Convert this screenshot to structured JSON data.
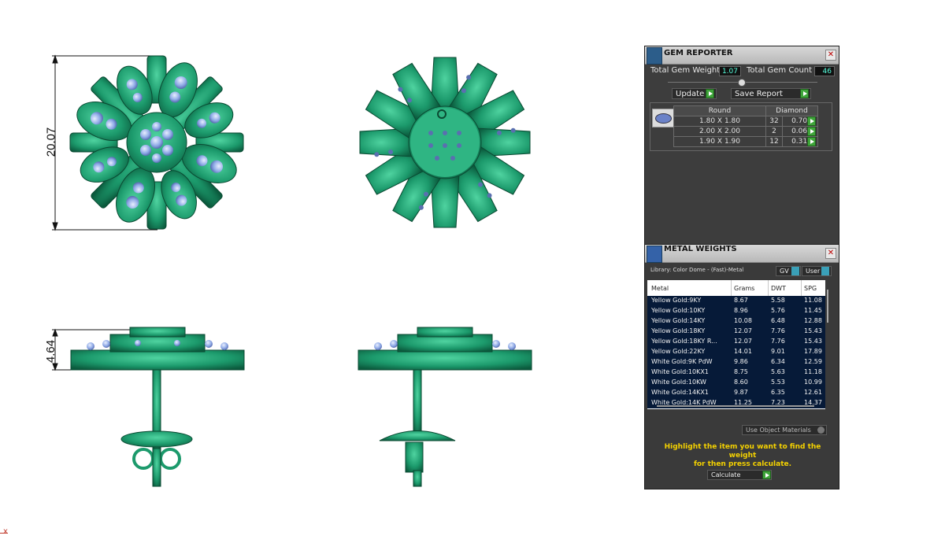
{
  "viewport": {
    "dimension_height_top": "20.07",
    "dimension_height_side": "4.64",
    "axis_label": "x"
  },
  "gem_reporter": {
    "title": "GEM REPORTER",
    "total_gem_weight_label": "Total Gem Weight",
    "total_gem_weight_value": "1.07",
    "total_gem_count_label": "Total Gem Count",
    "total_gem_count_value": "46",
    "update_label": "Update",
    "save_report_label": "Save Report",
    "table": {
      "shape": "Round",
      "material": "Diamond",
      "rows": [
        {
          "size": "1.80 X 1.80",
          "count": "32",
          "weight": "0.70tw"
        },
        {
          "size": "2.00 X 2.00",
          "count": "2",
          "weight": "0.06tw"
        },
        {
          "size": "1.90 X 1.90",
          "count": "12",
          "weight": "0.31tw"
        }
      ]
    }
  },
  "metal_weights": {
    "title": "METAL WEIGHTS",
    "library_label": "Library: Color Dome - (Fast)-Metal",
    "gv_label": "GV",
    "user_label": "User",
    "columns": [
      "Metal",
      "Grams",
      "DWT",
      "SPG"
    ],
    "rows": [
      {
        "metal": "Yellow Gold:9KY",
        "grams": "8.67",
        "dwt": "5.58",
        "spg": "11.08"
      },
      {
        "metal": "Yellow Gold:10KY",
        "grams": "8.96",
        "dwt": "5.76",
        "spg": "11.45"
      },
      {
        "metal": "Yellow Gold:14KY",
        "grams": "10.08",
        "dwt": "6.48",
        "spg": "12.88"
      },
      {
        "metal": "Yellow Gold:18KY",
        "grams": "12.07",
        "dwt": "7.76",
        "spg": "15.43"
      },
      {
        "metal": "Yellow Gold:18KY R...",
        "grams": "12.07",
        "dwt": "7.76",
        "spg": "15.43"
      },
      {
        "metal": "Yellow Gold:22KY",
        "grams": "14.01",
        "dwt": "9.01",
        "spg": "17.89"
      },
      {
        "metal": "White Gold:9K PdW",
        "grams": "9.86",
        "dwt": "6.34",
        "spg": "12.59"
      },
      {
        "metal": "White Gold:10KX1",
        "grams": "8.75",
        "dwt": "5.63",
        "spg": "11.18"
      },
      {
        "metal": "White Gold:10KW",
        "grams": "8.60",
        "dwt": "5.53",
        "spg": "10.99"
      },
      {
        "metal": "White Gold:14KX1",
        "grams": "9.87",
        "dwt": "6.35",
        "spg": "12.61"
      },
      {
        "metal": "White Gold:14K PdW",
        "grams": "11.25",
        "dwt": "7.23",
        "spg": "14.37"
      }
    ],
    "use_object_materials_label": "Use Object Materials",
    "hint_line1": "Highlight the item you want to find the weight",
    "hint_line2": "for then press calculate.",
    "calculate_label": "Calculate"
  },
  "colors": {
    "metal_green": "#1f9a6e",
    "gem_blue": "#8ea9e6",
    "panel_bg": "#3d3d3d",
    "hint_yellow": "#f4d100",
    "table_row_bg": "#061a38"
  }
}
